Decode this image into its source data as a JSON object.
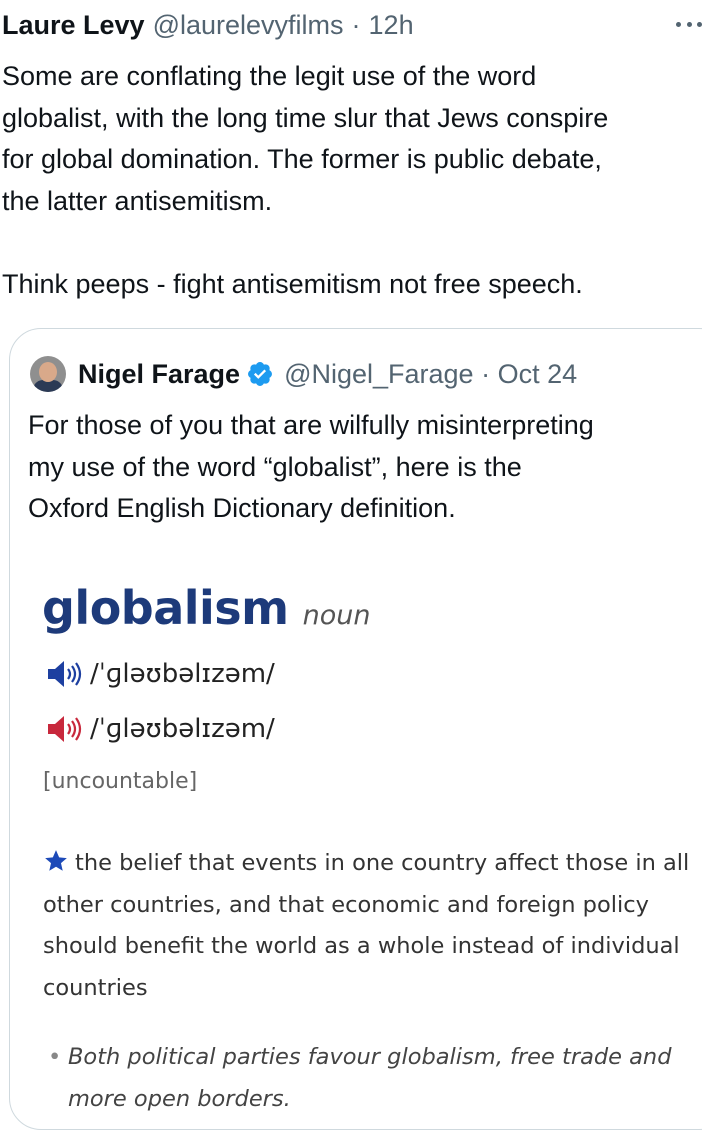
{
  "tweet": {
    "author_name": "Laure Levy",
    "author_handle": "@laurelevyfilms",
    "separator": "·",
    "time": "12h",
    "body_lines": [
      "Some are conflating the legit use of the word",
      "globalist, with the long time slur that Jews conspire",
      "for global domination. The former is public debate,",
      "the latter antisemitism."
    ],
    "body_para2": "Think peeps - fight antisemitism not free speech."
  },
  "quote": {
    "author_name": "Nigel Farage",
    "author_handle": "@Nigel_Farage",
    "separator": "·",
    "time": "Oct 24",
    "text_lines": [
      "For those of you that are wilfully misinterpreting",
      "my use of the word “globalist”, here is the",
      "Oxford English Dictionary definition."
    ]
  },
  "dictionary": {
    "headword": "globalism",
    "part_of_speech": "noun",
    "pron_uk": "/ˈɡləʊbəlɪzəm/",
    "pron_us": "/ˈɡləʊbəlɪzəm/",
    "grammar": "[uncountable]",
    "definition_lines": [
      "the belief that events in one country affect those in all",
      "other countries, and that economic and foreign policy",
      "should benefit the world as a whole instead of individual",
      "countries"
    ],
    "example_bullet": "•",
    "example_lines": [
      "Both political parties favour globalism, free trade and",
      "more open borders."
    ],
    "colors": {
      "headword": "#1d3a7a",
      "speaker_uk": "#1d3fa0",
      "speaker_us": "#c8283c",
      "star": "#1d4ab8",
      "verified": "#1d9bf0"
    }
  }
}
